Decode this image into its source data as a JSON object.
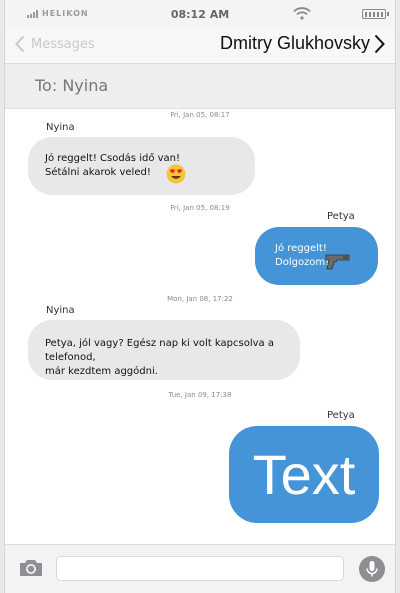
{
  "status": {
    "carrier": "HELIKON",
    "time": "08:12 AM"
  },
  "nav": {
    "back_label": "Messages",
    "contact_name": "Dmitry Glukhovsky"
  },
  "to_bar": {
    "label": "To: Nyina"
  },
  "messages": [
    {
      "timestamp": "Fri, Jan 05, 08:17",
      "sender": "Nyina",
      "direction": "incoming",
      "lines": [
        "Jó reggelt! Csodás idő van!",
        "Sétálni akarok veled!"
      ],
      "emoji": "heart-eyes-emoji"
    },
    {
      "timestamp": "Fri, Jan 05, 08:19",
      "sender": "Petya",
      "direction": "outgoing",
      "lines": [
        "Jó reggelt!",
        "Dolgozom!"
      ],
      "emoji": "pistol-emoji"
    },
    {
      "timestamp": "Mon, Jan 08, 17:22",
      "sender": "Nyina",
      "direction": "incoming",
      "lines": [
        "Petya, jól vagy? Egész nap ki volt kapcsolva a telefonod,",
        "már kezdtem aggódni."
      ]
    },
    {
      "timestamp": "Tue, Jan 09, 17:38",
      "sender": "Petya",
      "direction": "outgoing",
      "lines": [
        "Text"
      ]
    }
  ],
  "composer": {
    "placeholder": ""
  },
  "colors": {
    "outgoing_bubble": "#4694d8",
    "incoming_bubble": "#e8e8ea",
    "mic_button": "#8e8e93"
  },
  "icons": {
    "camera": "camera-icon",
    "mic": "microphone-icon",
    "back": "chevron-left-icon",
    "forward": "chevron-right-icon",
    "wifi": "wifi-icon",
    "battery": "battery-icon",
    "signal": "signal-icon"
  }
}
